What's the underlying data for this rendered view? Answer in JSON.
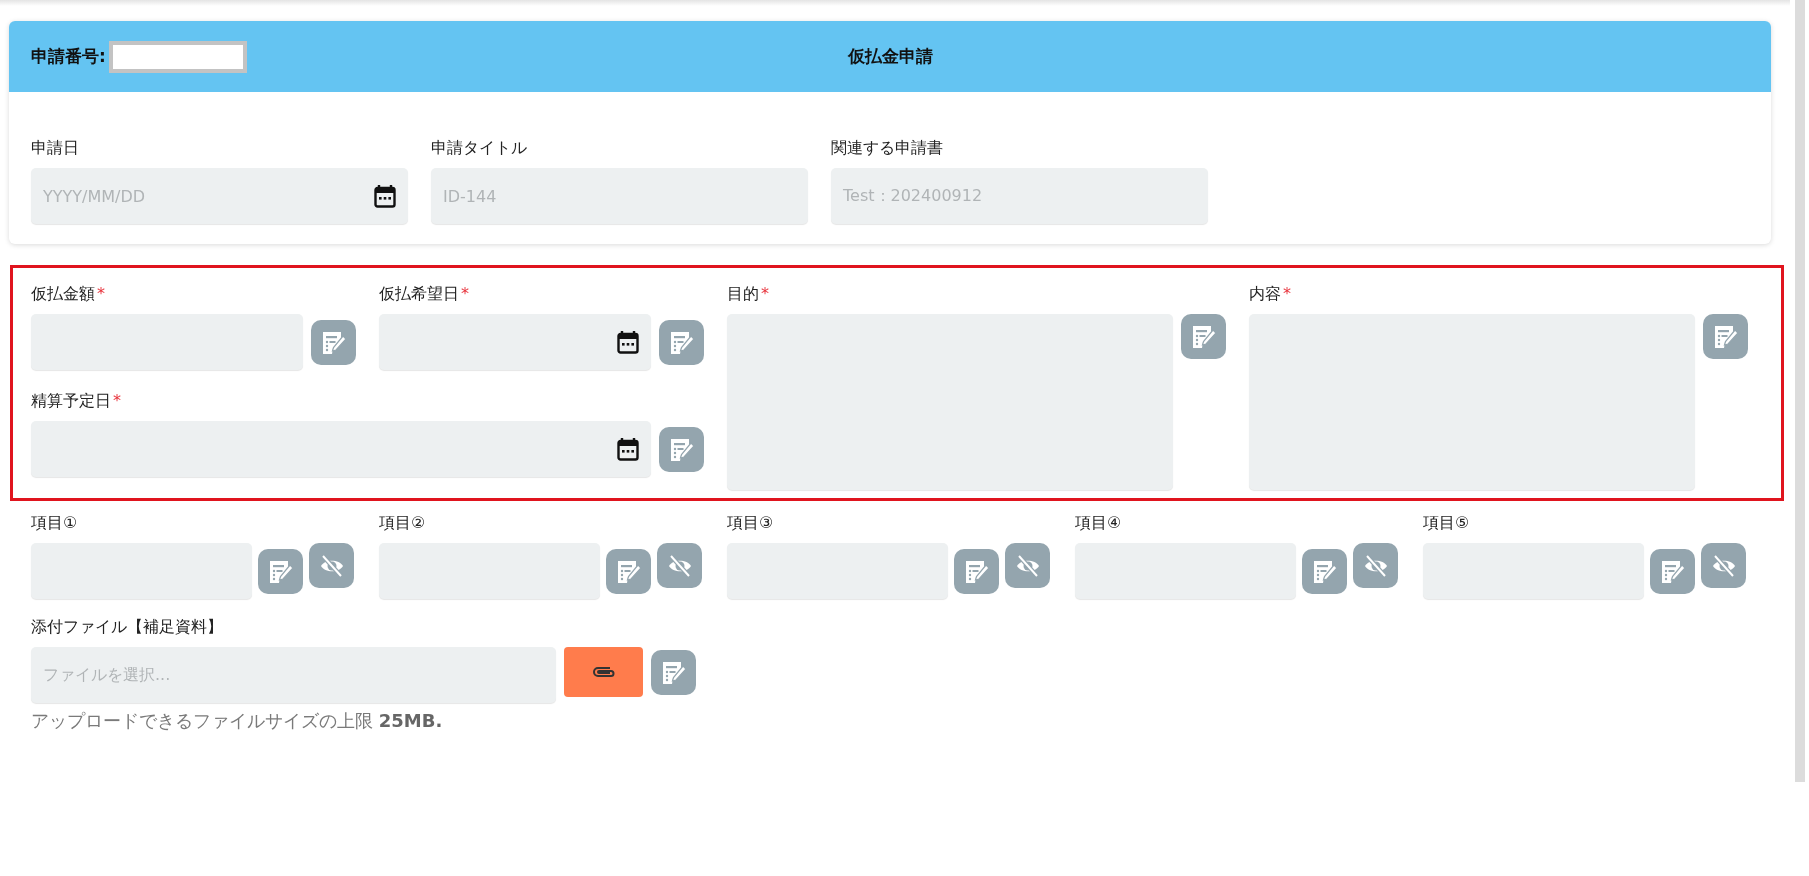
{
  "header": {
    "number_label": "申請番号:",
    "title": "仮払金申請"
  },
  "basic_fields": [
    {
      "label": "申請日",
      "placeholder": "YYYY/MM/DD",
      "kind": "date"
    },
    {
      "label": "申請タイトル",
      "placeholder": "ID-144",
      "kind": "text"
    },
    {
      "label": "関連する申請書",
      "placeholder": "Test：202400912",
      "kind": "text"
    }
  ],
  "required_mark": "*",
  "required_fields": [
    {
      "label": "仮払金額",
      "required": true,
      "kind": "text"
    },
    {
      "label": "仮払希望日",
      "required": true,
      "kind": "date"
    },
    {
      "label": "目的",
      "required": true,
      "kind": "textarea"
    },
    {
      "label": "内容",
      "required": true,
      "kind": "textarea"
    },
    {
      "label": "精算予定日",
      "required": true,
      "kind": "date"
    }
  ],
  "items": [
    {
      "label": "項目①"
    },
    {
      "label": "項目②"
    },
    {
      "label": "項目③"
    },
    {
      "label": "項目④"
    },
    {
      "label": "項目⑤"
    }
  ],
  "attachment": {
    "label": "添付ファイル【補足資料】",
    "placeholder": "ファイルを選択...",
    "note": "アップロードできるファイルサイズの上限 **25MB.**"
  }
}
